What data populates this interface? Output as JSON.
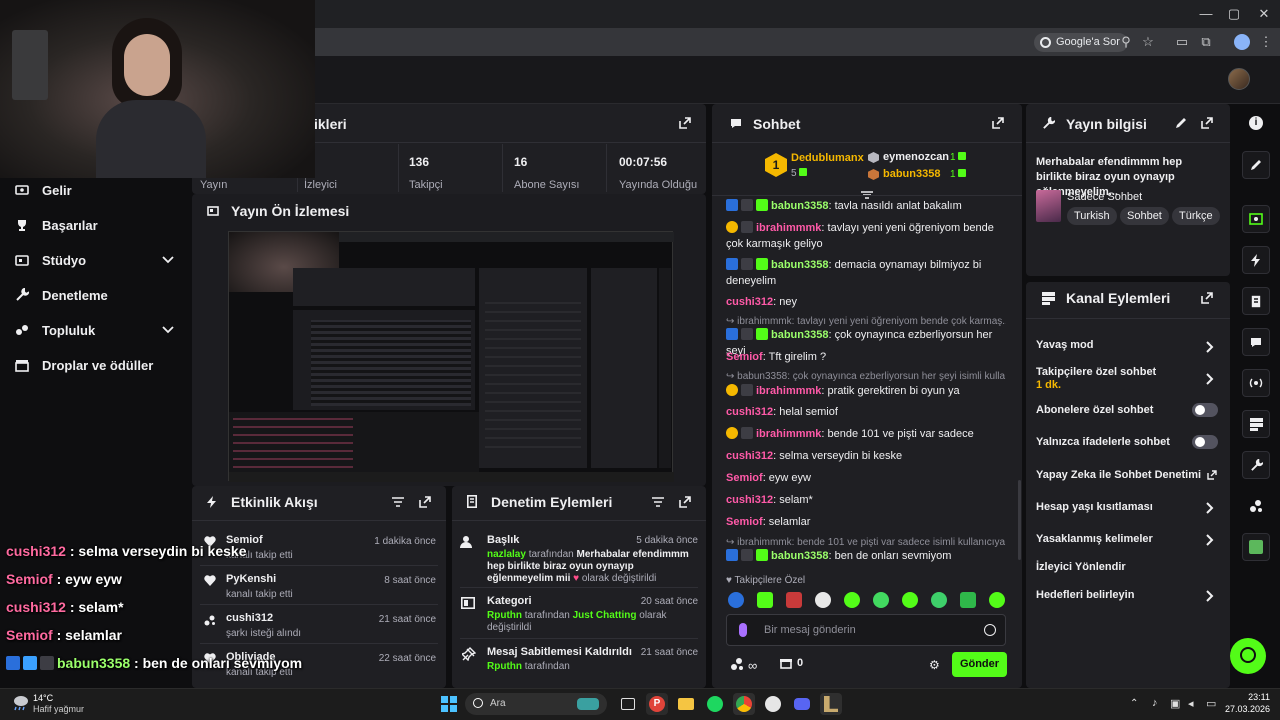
{
  "browser": {
    "google_sor": "Google'a Sor",
    "win_min": "—",
    "win_max": "▢",
    "win_close": "✕"
  },
  "sidebar": {
    "items": [
      {
        "label": "Gelir",
        "icon": "dollar-icon"
      },
      {
        "label": "Başarılar",
        "icon": "trophy-icon"
      },
      {
        "label": "Stüdyo",
        "icon": "studio-icon"
      },
      {
        "label": "Denetleme",
        "icon": "wrench-icon"
      },
      {
        "label": "Topluluk",
        "icon": "community-icon"
      },
      {
        "label": "Droplar ve ödüller",
        "icon": "drops-icon"
      }
    ]
  },
  "stats": {
    "title_suffix": "ikleri",
    "items": [
      {
        "value": "",
        "label": "Yayın"
      },
      {
        "value": "",
        "label": "İzleyici"
      },
      {
        "value": "136",
        "label": "Takipçi"
      },
      {
        "value": "16",
        "label": "Abone Sayısı"
      },
      {
        "value": "00:07:56",
        "label": "Yayında Olduğu"
      }
    ]
  },
  "preview": {
    "title": "Yayın Ön İzlemesi"
  },
  "activity": {
    "title": "Etkinlik Akışı",
    "items": [
      {
        "name": "Semiof",
        "desc": "kanalı takip etti",
        "time": "1 dakika önce"
      },
      {
        "name": "PyKenshi",
        "desc": "kanalı takip etti",
        "time": "8 saat önce"
      },
      {
        "name": "cushi312",
        "desc": "şarkı isteği alındı",
        "time": "21 saat önce"
      },
      {
        "name": "Obliviade",
        "desc": "kanalı takip etti",
        "time": "22 saat önce"
      }
    ]
  },
  "modactions": {
    "title": "Denetim Eylemleri",
    "items": [
      {
        "title": "Başlık",
        "time": "5 dakika önce",
        "user": "nazlalay",
        "rest": " tarafından ",
        "text": "Merhabalar efendimmm hep birlikte biraz oyun oynayıp eğlenmeyelim mii",
        "suffix": "olarak değiştirildi"
      },
      {
        "title": "Kategori",
        "time": "20 saat önce",
        "user": "Rputhn",
        "rest": " tarafından ",
        "text": "Just Chatting",
        "suffix": " olarak değiştirildi"
      },
      {
        "title": "Mesaj Sabitlemesi Kaldırıldı",
        "time": "21 saat önce",
        "user": "Rputhn",
        "rest": " tarafından",
        "text": "",
        "suffix": ""
      }
    ]
  },
  "chat": {
    "title": "Sohbet",
    "leaderboard": [
      {
        "rank": "1",
        "name": "Dedublumanx",
        "count": "5"
      },
      {
        "rank": "",
        "name": "eymenozcan",
        "count": "1"
      },
      {
        "rank": "",
        "name": "babun3358",
        "count": "1"
      }
    ],
    "messages": [
      {
        "user": "babun3358",
        "text": ": tavla nasıldı anlat bakalım",
        "color": "#9bff6b"
      },
      {
        "user": "ibrahimmmk",
        "text": ": tavlayı yeni yeni öğreniyom bende çok karmaşık geliyo",
        "color": "#ff5aa8"
      },
      {
        "user": "babun3358",
        "text": ": demacia oynamayı bilmiyoz bi deneyelim",
        "color": "#9bff6b"
      },
      {
        "user": "cushi312",
        "text": ": ney",
        "color": "#ff5aa8"
      },
      {
        "user": "babun3358",
        "text": ": çok oynayınca ezberliyorsun her şeyi",
        "color": "#9bff6b"
      },
      {
        "user": "Semiof",
        "text": ": Tft girelim ?",
        "color": "#ff5aa8"
      },
      {
        "user": "ibrahimmmk",
        "text": ": pratik gerektiren bi oyun ya",
        "color": "#ff5aa8"
      },
      {
        "user": "cushi312",
        "text": ": helal semiof",
        "color": "#ff5aa8"
      },
      {
        "user": "ibrahimmmk",
        "text": ": bende 101 ve pişti var sadece",
        "color": "#ff5aa8"
      },
      {
        "user": "cushi312",
        "text": ": selma verseydin bi keske",
        "color": "#ff5aa8"
      },
      {
        "user": "Semiof",
        "text": ": eyw eyw",
        "color": "#ff5aa8"
      },
      {
        "user": "cushi312",
        "text": ": selam*",
        "color": "#ff5aa8"
      },
      {
        "user": "Semiof",
        "text": ": selamlar",
        "color": "#ff5aa8"
      },
      {
        "user": "babun3358",
        "text": ": ben de onları sevmiyom",
        "color": "#9bff6b"
      }
    ],
    "replies": [
      "ibrahimmmk: tavlayı yeni yeni öğreniyom bende çok karmaş...",
      "babun3358: çok oynayınca ezberliyorsun her şeyi isimli kulla...",
      "ibrahimmmk: bende 101 ve pişti var sadece isimli kullanıcıya y..."
    ],
    "followers_only": "Takipçilere Özel",
    "placeholder": "Bir mesaj gönderin",
    "points": "0",
    "send": "Gönder"
  },
  "info": {
    "title": "Yayın bilgisi",
    "stream_title": "Merhabalar efendimmm hep birlikte biraz oyun oynayıp eğlenmeyelim...",
    "category": "Sadece Sohbet",
    "tags": [
      "Turkish",
      "Sohbet",
      "Türkçe"
    ]
  },
  "channel": {
    "title": "Kanal Eylemleri",
    "items": [
      {
        "label": "Yavaş mod",
        "sub": "",
        "control": "chevron"
      },
      {
        "label": "Takipçilere özel sohbet",
        "sub": "1 dk.",
        "control": "chevron"
      },
      {
        "label": "Abonelere özel sohbet",
        "sub": "",
        "control": "toggle"
      },
      {
        "label": "Yalnızca ifadelerle sohbet",
        "sub": "",
        "control": "toggle"
      },
      {
        "label": "Yapay Zeka ile Sohbet Denetimi",
        "sub": "",
        "control": "external"
      },
      {
        "label": "Hesap yaşı kısıtlaması",
        "sub": "",
        "control": "chevron"
      },
      {
        "label": "Yasaklanmış kelimeler",
        "sub": "",
        "control": "chevron"
      },
      {
        "label": "İzleyici Yönlendir",
        "sub": "",
        "control": "none"
      },
      {
        "label": "Hedefleri belirleyin",
        "sub": "",
        "control": "chevron"
      }
    ]
  },
  "overlay": {
    "lines": [
      {
        "user": "cushi312",
        "text": " : selma verseydin bi keske",
        "color": "#ff6aa0"
      },
      {
        "user": "Semiof",
        "text": " : eyw eyw",
        "color": "#ff6aa0"
      },
      {
        "user": "cushi312",
        "text": " : selam*",
        "color": "#ff6aa0"
      },
      {
        "user": "Semiof",
        "text": " : selamlar",
        "color": "#ff6aa0"
      },
      {
        "user": "babun3358",
        "text": " : ben de onları sevmiyom",
        "color": "#9bff6b"
      }
    ]
  },
  "taskbar": {
    "weather_temp": "14°C",
    "weather_desc": "Hafif yağmur",
    "search": "Ara",
    "time": "23:11",
    "date": "27.03.2026"
  },
  "colors": {
    "accent": "#53fc18",
    "panel": "#1f1f23",
    "bg": "#0e0e10"
  }
}
